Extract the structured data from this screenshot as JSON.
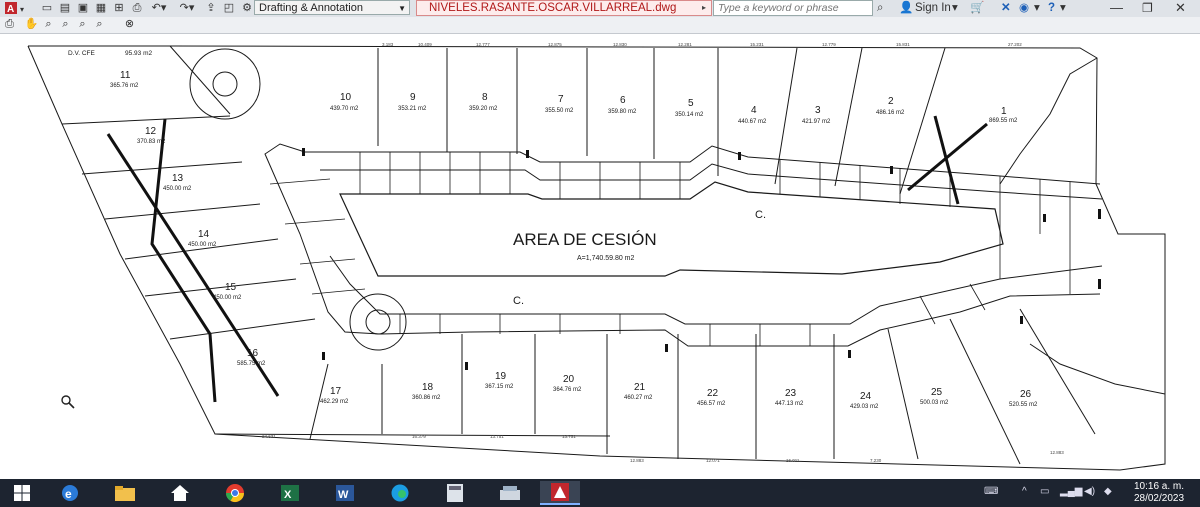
{
  "titlebar": {
    "workspace": "Drafting & Annotation",
    "document_title": "NIVELES.RASANTE.OSCAR.VILLARREAL.dwg",
    "search_placeholder": "Type a keyword or phrase",
    "sign_in": "Sign In",
    "help": "?"
  },
  "drawing": {
    "area_title": "AREA DE CESIÓN",
    "area_value": "A=1,740.59.80  m2",
    "street_label_top": "C.",
    "street_label_bottom": "C.",
    "dv_label": "D.V. CFE",
    "dv_area": "95.93 m2",
    "lots": [
      {
        "num": "1",
        "area": "869.55 m2"
      },
      {
        "num": "2",
        "area": "486.16 m2"
      },
      {
        "num": "3",
        "area": "421.97 m2"
      },
      {
        "num": "4",
        "area": "440.67 m2"
      },
      {
        "num": "5",
        "area": "350.14 m2"
      },
      {
        "num": "6",
        "area": "359.80 m2"
      },
      {
        "num": "7",
        "area": "355.50 m2"
      },
      {
        "num": "8",
        "area": "359.20 m2"
      },
      {
        "num": "9",
        "area": "353.21 m2"
      },
      {
        "num": "10",
        "area": "439.70 m2"
      },
      {
        "num": "11",
        "area": "365.76 m2"
      },
      {
        "num": "12",
        "area": "370.83 m2"
      },
      {
        "num": "13",
        "area": "450.00 m2"
      },
      {
        "num": "14",
        "area": "450.00 m2"
      },
      {
        "num": "15",
        "area": "450.00 m2"
      },
      {
        "num": "16",
        "area": "585.75 m2"
      },
      {
        "num": "17",
        "area": "462.29 m2"
      },
      {
        "num": "18",
        "area": "360.86 m2"
      },
      {
        "num": "19",
        "area": "367.15 m2"
      },
      {
        "num": "20",
        "area": "364.76 m2"
      },
      {
        "num": "21",
        "area": "460.27 m2"
      },
      {
        "num": "22",
        "area": "456.57 m2"
      },
      {
        "num": "23",
        "area": "447.13 m2"
      },
      {
        "num": "24",
        "area": "429.03 m2"
      },
      {
        "num": "25",
        "area": "500.03 m2"
      },
      {
        "num": "26",
        "area": "520.55 m2"
      }
    ],
    "dims_top": [
      "3.183",
      "10.409",
      "12.777",
      "12.875",
      "12.830",
      "12.281",
      "15.231",
      "12.779",
      "15.831",
      "27.202"
    ],
    "dims_bottom": [
      "24.631",
      "16.379",
      "13.751",
      "13.751",
      "12.883",
      "12.071",
      "16.011",
      "7.230",
      "12.883"
    ]
  },
  "taskbar": {
    "apps": [
      "start-icon",
      "edge-legacy-icon",
      "file-explorer-icon",
      "home-icon",
      "chrome-icon",
      "excel-icon",
      "word-icon",
      "edge-icon",
      "calculator-icon",
      "scanner-icon",
      "autocad-icon"
    ],
    "time": "10:16 a. m.",
    "date": "28/02/2023"
  },
  "colors": {
    "title_red": "#b01818",
    "taskbar": "#1d2430",
    "lines": "#1a1a1a"
  }
}
